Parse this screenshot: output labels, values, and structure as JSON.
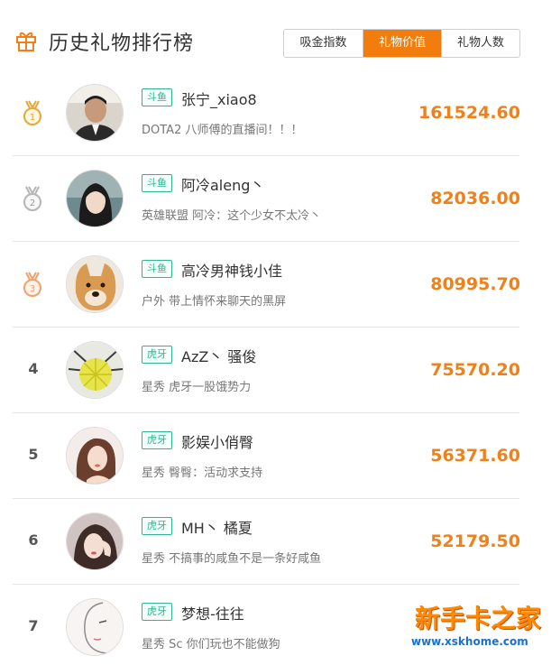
{
  "header": {
    "title": "历史礼物排行榜",
    "tabs": [
      {
        "label": "吸金指数",
        "active": false
      },
      {
        "label": "礼物价值",
        "active": true
      },
      {
        "label": "礼物人数",
        "active": false
      }
    ],
    "accent_color": "#f27d0c"
  },
  "rankings": [
    {
      "rank": "1",
      "platform": "斗鱼",
      "name": "张宁_xiao8",
      "desc": "DOTA2 八师傅的直播间！！！",
      "value": "161524.60",
      "medal": "gold"
    },
    {
      "rank": "2",
      "platform": "斗鱼",
      "name": "阿冷aleng丶",
      "desc": "英雄联盟 阿冷：这个少女不太冷丶",
      "value": "82036.00",
      "medal": "silver"
    },
    {
      "rank": "3",
      "platform": "斗鱼",
      "name": "高冷男神钱小佳",
      "desc": "户外 带上情怀来聊天的黑屏",
      "value": "80995.70",
      "medal": "bronze"
    },
    {
      "rank": "4",
      "platform": "虎牙",
      "name": "AzZ丶 骚俊",
      "desc": "星秀 虎牙一股饿势力",
      "value": "75570.20"
    },
    {
      "rank": "5",
      "platform": "虎牙",
      "name": "影娱小俏臀",
      "desc": "星秀 臀臀：活动求支持",
      "value": "56371.60"
    },
    {
      "rank": "6",
      "platform": "虎牙",
      "name": "MH丶 橘夏",
      "desc": "星秀 不搞事的咸鱼不是一条好咸鱼",
      "value": "52179.50"
    },
    {
      "rank": "7",
      "platform": "虎牙",
      "name": "梦想-往往",
      "desc": "星秀 Sc 你们玩也不能做狗",
      "value": ""
    }
  ],
  "watermark": {
    "text": "新手卡之家",
    "url": "www.xskhome.com"
  }
}
